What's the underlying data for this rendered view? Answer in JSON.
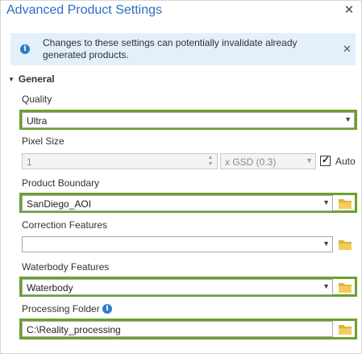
{
  "window": {
    "title": "Advanced Product Settings",
    "close_label": "✕"
  },
  "notice": {
    "icon": "info-icon",
    "message": "Changes to these settings can potentially invalidate already generated products.",
    "close_label": "✕"
  },
  "section": {
    "label": "General",
    "expanded": true
  },
  "fields": {
    "quality": {
      "label": "Quality",
      "value": "Ultra",
      "highlighted": true
    },
    "pixel_size": {
      "label": "Pixel Size",
      "value": "1",
      "unit": "x GSD (0.3)",
      "auto_label": "Auto",
      "auto_checked": true,
      "enabled": false
    },
    "product_boundary": {
      "label": "Product Boundary",
      "value": "SanDiego_AOI",
      "highlighted": true
    },
    "correction_features": {
      "label": "Correction Features",
      "value": "",
      "highlighted": false
    },
    "waterbody_features": {
      "label": "Waterbody Features",
      "value": "Waterbody",
      "highlighted": true
    },
    "processing_folder": {
      "label": "Processing Folder",
      "value": "C:\\Reality_processing",
      "highlighted": true,
      "info_icon": "info-icon"
    }
  },
  "colors": {
    "accent": "#2a70c1",
    "highlight": "#6aa22b",
    "notice_bg": "#e3effa",
    "folder": "#e0b33a"
  }
}
